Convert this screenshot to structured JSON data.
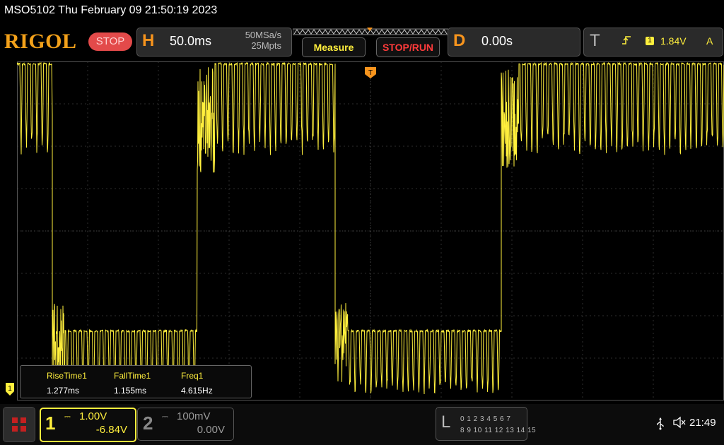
{
  "title": "MSO5102  Thu February 09 21:50:19 2023",
  "brand": "RIGOL",
  "run_state": "STOP",
  "horizontal": {
    "letter": "H",
    "timebase": "50.0ms",
    "sample_rate": "50MSa/s",
    "memory_depth": "25Mpts"
  },
  "buttons": {
    "measure": "Measure",
    "stop_run": "STOP/RUN"
  },
  "delay": {
    "letter": "D",
    "value": "0.00s"
  },
  "trigger": {
    "letter": "T",
    "slope_icon": "rising-edge-icon",
    "source": "1",
    "level": "1.84V",
    "mode": "A",
    "marker": "T"
  },
  "measurements": {
    "headers": [
      "RiseTime1",
      "FallTime1",
      "Freq1"
    ],
    "values": [
      "1.277ms",
      "1.155ms",
      "4.615Hz"
    ]
  },
  "ch1": {
    "number": "1",
    "coupling": "⎓",
    "scale": "1.00V",
    "offset": "-6.84V",
    "marker": "1"
  },
  "ch2": {
    "number": "2",
    "coupling": "⎓",
    "scale": "100mV",
    "offset": "0.00V"
  },
  "logic": {
    "letter": "L",
    "row1": "0 1 2 3  4 5 6 7",
    "row2": "8 9 10 11 12 13 14 15"
  },
  "status": {
    "usb_icon": "usb-icon",
    "mute_icon": "mute-icon",
    "time": "21:49"
  },
  "colors": {
    "ch1": "#ffef3d",
    "accent": "#f7941d",
    "stop": "#e34a4a",
    "grid": "#3a3a3a"
  },
  "waveform": {
    "segments": [
      {
        "level": "high",
        "from_div": 0.0,
        "to_div": 1.0
      },
      {
        "level": "low",
        "from_div": 1.0,
        "to_div": 5.1
      },
      {
        "level": "high",
        "from_div": 5.1,
        "to_div": 9.0
      },
      {
        "level": "low",
        "from_div": 9.0,
        "to_div": 13.7
      },
      {
        "level": "high",
        "from_div": 13.7,
        "to_div": 20.0
      }
    ]
  }
}
